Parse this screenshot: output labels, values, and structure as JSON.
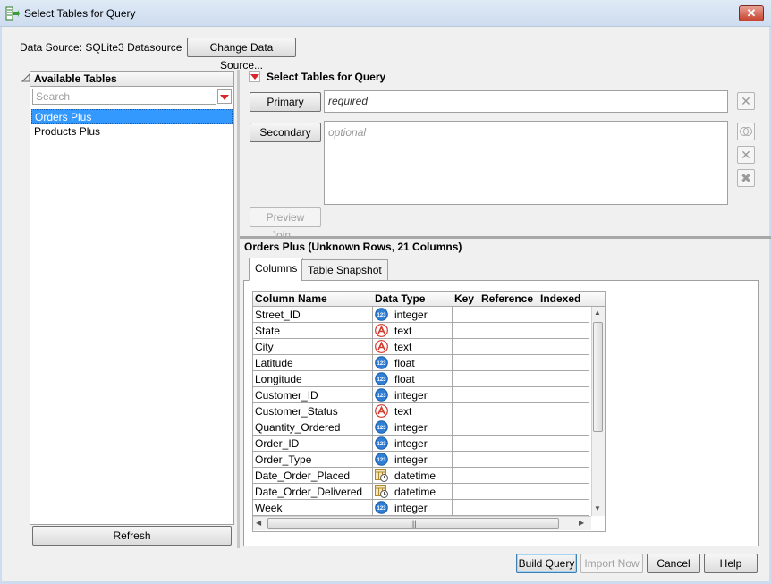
{
  "window": {
    "title": "Select Tables for Query",
    "close_glyph": "✕"
  },
  "datasource": {
    "label": "Data Source:  SQLite3 Datasource",
    "change_button": "Change Data Source..."
  },
  "left": {
    "header": "Available Tables",
    "search_placeholder": "Search",
    "tables": [
      "Orders Plus",
      "Products Plus"
    ],
    "selected_index": 0,
    "refresh_button": "Refresh"
  },
  "select_panel": {
    "title": "Select Tables for Query",
    "primary_button": "Primary",
    "primary_value": "required",
    "secondary_button": "Secondary",
    "secondary_value": "optional",
    "preview_button": "Preview Join..."
  },
  "details": {
    "title": "Orders Plus    (Unknown Rows, 21 Columns)",
    "tabs": [
      "Columns",
      "Table Snapshot"
    ],
    "active_tab": "Columns",
    "columns": [
      "Column Name",
      "Data Type",
      "Key",
      "Reference",
      "Indexed"
    ],
    "rows": [
      {
        "name": "Street_ID",
        "type": "integer",
        "icon": "numeric-icon"
      },
      {
        "name": "State",
        "type": "text",
        "icon": "text-icon"
      },
      {
        "name": "City",
        "type": "text",
        "icon": "text-icon"
      },
      {
        "name": "Latitude",
        "type": "float",
        "icon": "numeric-icon"
      },
      {
        "name": "Longitude",
        "type": "float",
        "icon": "numeric-icon"
      },
      {
        "name": "Customer_ID",
        "type": "integer",
        "icon": "numeric-icon"
      },
      {
        "name": "Customer_Status",
        "type": "text",
        "icon": "text-icon"
      },
      {
        "name": "Quantity_Ordered",
        "type": "integer",
        "icon": "numeric-icon"
      },
      {
        "name": "Order_ID",
        "type": "integer",
        "icon": "numeric-icon"
      },
      {
        "name": "Order_Type",
        "type": "integer",
        "icon": "numeric-icon"
      },
      {
        "name": "Date_Order_Placed",
        "type": "datetime",
        "icon": "datetime-icon"
      },
      {
        "name": "Date_Order_Delivered",
        "type": "datetime",
        "icon": "datetime-icon"
      },
      {
        "name": "Week",
        "type": "integer",
        "icon": "numeric-icon"
      }
    ]
  },
  "footer": {
    "build": "Build Query",
    "import": "Import Now",
    "cancel": "Cancel",
    "help": "Help"
  },
  "colors": {
    "selection": "#3399ff",
    "accent_red": "#d8242a",
    "numeric_icon": "#2f7fd6",
    "text_icon": "#d33a2c"
  }
}
